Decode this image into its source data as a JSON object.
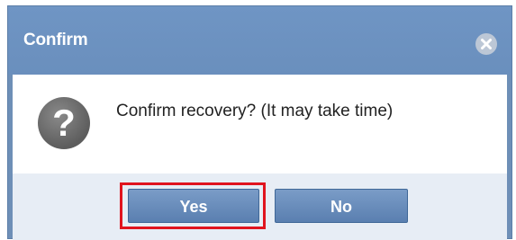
{
  "dialog": {
    "title": "Confirm",
    "message": "Confirm recovery? (It may take time)",
    "icon": "question-icon",
    "close_icon": "close-icon"
  },
  "buttons": {
    "yes_label": "Yes",
    "no_label": "No"
  },
  "colors": {
    "titlebar": "#6f95c4",
    "button": "#6a8fbd",
    "highlight": "#e0141e",
    "footer": "#e7edf5"
  }
}
